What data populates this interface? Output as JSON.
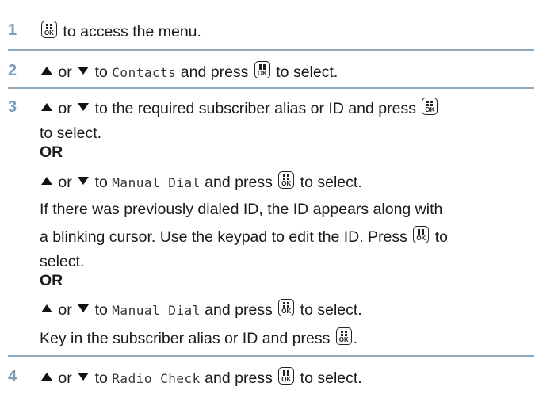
{
  "steps": [
    {
      "number": "1"
    },
    {
      "number": "2"
    },
    {
      "number": "3"
    },
    {
      "number": "4"
    }
  ],
  "key_label": "OK",
  "or_label": "OR",
  "text": {
    "s1": " to access the menu.",
    "or_word": " or ",
    "to": " to ",
    "and_press": " and press ",
    "to_select_after_key": " to select.",
    "contacts": "Contacts",
    "manual_dial": "Manual Dial",
    "radio_check": "Radio Check",
    "s3_a": " to the required subscriber alias or ID and press ",
    "s3_b": "to select.",
    "p1": "If there was previously dialed ID, the ID appears along with",
    "p2": "a blinking cursor. Use the keypad to edit the ID. Press ",
    "p2_end": " to",
    "p3": "select.",
    "p4": " Key in the subscriber alias or ID and press ",
    "p4_end": "."
  }
}
